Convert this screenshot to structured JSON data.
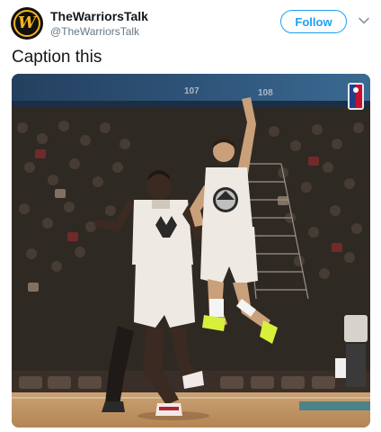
{
  "account": {
    "display_name": "TheWarriorsTalk",
    "handle": "@TheWarriorsTalk",
    "avatar_letter": "W",
    "avatar_colors": {
      "bg": "#101010",
      "accent": "#f2b41e"
    }
  },
  "actions": {
    "follow_label": "Follow",
    "more_icon": "chevron-down-icon"
  },
  "tweet": {
    "text": "Caption this"
  },
  "photo": {
    "sign_left": "107",
    "sign_right": "108",
    "colors": {
      "crowd": "#2a2622",
      "arena_top": "#2b4c6e",
      "court": "#c49a68",
      "jersey": "#eeeae3",
      "shoe_neon": "#d8f03a"
    }
  },
  "theme": {
    "accent": "#1da1f2",
    "text": "#14171a",
    "muted": "#657786"
  }
}
